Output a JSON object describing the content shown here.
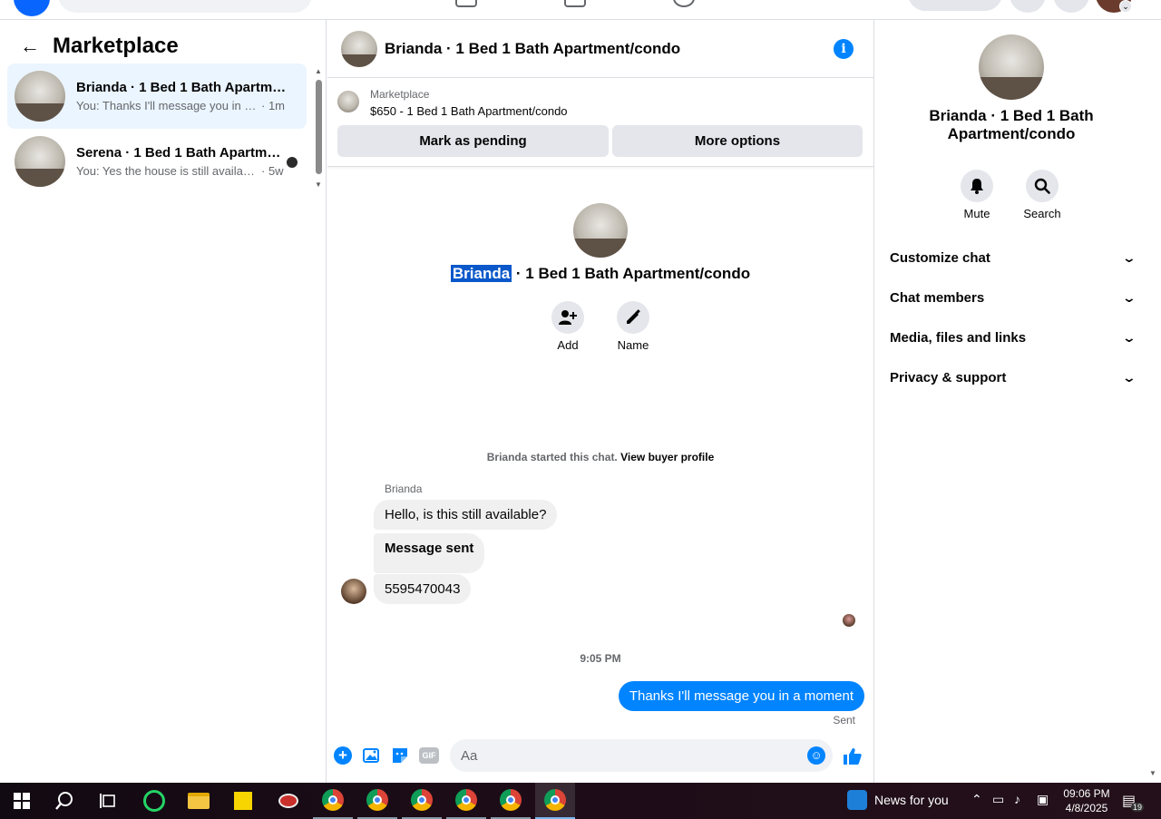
{
  "topbar": {
    "avatar_badge": "⌄"
  },
  "sidebar": {
    "title": "Marketplace",
    "conversations": [
      {
        "name": "Brianda · 1 Bed 1 Bath Apartment/condo",
        "snippet": "You: Thanks I'll message you in a ...",
        "time": "· 1m"
      },
      {
        "name": "Serena · 1 Bed 1 Bath Apartment/condo",
        "snippet": "You: Yes the house is still availab...",
        "time": "· 5w"
      }
    ]
  },
  "chat": {
    "header_title": "Brianda · 1 Bed 1 Bath Apartment/condo",
    "listing": {
      "label": "Marketplace",
      "price_title": "$650 - 1 Bed 1 Bath Apartment/condo",
      "mark_pending": "Mark as pending",
      "more_options": "More options"
    },
    "intro": {
      "name_highlight": "Brianda",
      "name_rest": " · 1 Bed 1 Bath Apartment/condo",
      "add_label": "Add",
      "name_label": "Name"
    },
    "started_text": "Brianda started this chat. ",
    "view_profile": "View buyer profile",
    "sender": "Brianda",
    "messages_in": [
      "Hello, is this still available?",
      "Message sent",
      "5595470043"
    ],
    "timestamp": "9:05 PM",
    "message_out": "Thanks I'll message you in a moment",
    "sent_label": "Sent",
    "composer_placeholder": "Aa",
    "gif_label": "GIF"
  },
  "details": {
    "title": "Brianda · 1 Bed 1 Bath Apartment/condo",
    "mute_label": "Mute",
    "search_label": "Search",
    "sections": [
      "Customize chat",
      "Chat members",
      "Media, files and links",
      "Privacy & support"
    ]
  },
  "taskbar": {
    "news": "News for you",
    "time": "09:06 PM",
    "date": "4/8/2025",
    "notifications": "19"
  },
  "colors": {
    "accent": "#0084ff",
    "active_conversation": "#ebf5ff",
    "highlight": "#0a58ca"
  }
}
